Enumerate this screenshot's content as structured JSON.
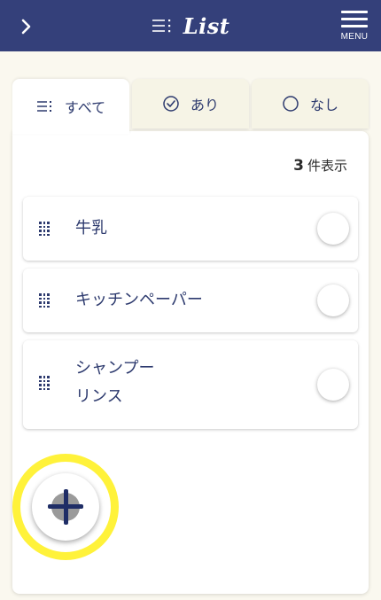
{
  "header": {
    "title": "List",
    "menu_label": "MENU",
    "back_icon": "chevron-right-icon",
    "title_icon": "list-icon",
    "background": "#34407a"
  },
  "tabs": [
    {
      "label": "すべて",
      "icon": "list-icon",
      "active": true
    },
    {
      "label": "あり",
      "icon": "check-circle-icon",
      "active": false
    },
    {
      "label": "なし",
      "icon": "circle-icon",
      "active": false
    }
  ],
  "count": {
    "number": "3",
    "suffix": "件表示"
  },
  "items": [
    {
      "label": "牛乳",
      "checked": false
    },
    {
      "label": "キッチンペーパー",
      "checked": false
    },
    {
      "label": "シャンプー\nリンス",
      "checked": false
    }
  ],
  "fab": {
    "icon": "plus-icon",
    "highlight_color": "#fff23a"
  }
}
